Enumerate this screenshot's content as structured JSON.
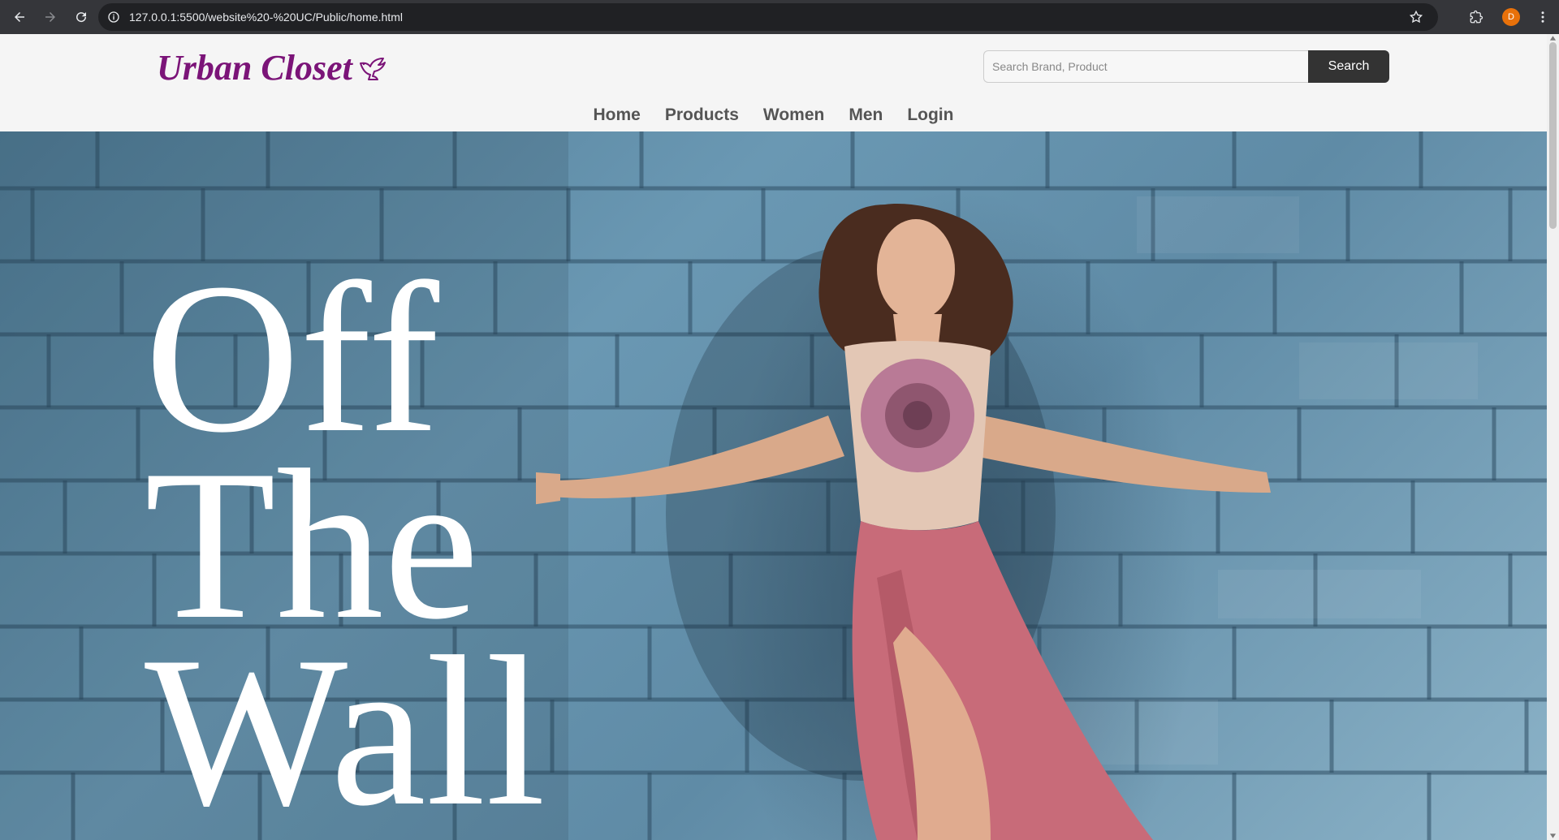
{
  "browser": {
    "url": "127.0.0.1:5500/website%20-%20UC/Public/home.html",
    "profile_initial": "D",
    "icons": [
      "back-arrow-icon",
      "forward-arrow-icon",
      "reload-icon",
      "info-icon",
      "star-icon",
      "extensions-icon",
      "kebab-menu-icon"
    ]
  },
  "site": {
    "logo_text": "Urban Closet",
    "brand_color": "#7b1478",
    "search": {
      "placeholder": "Search Brand, Product",
      "button_label": "Search"
    },
    "nav": [
      {
        "label": "Home"
      },
      {
        "label": "Products"
      },
      {
        "label": "Women"
      },
      {
        "label": "Men"
      },
      {
        "label": "Login"
      }
    ]
  },
  "hero": {
    "lines": [
      "Off",
      "The",
      "Wall"
    ]
  }
}
